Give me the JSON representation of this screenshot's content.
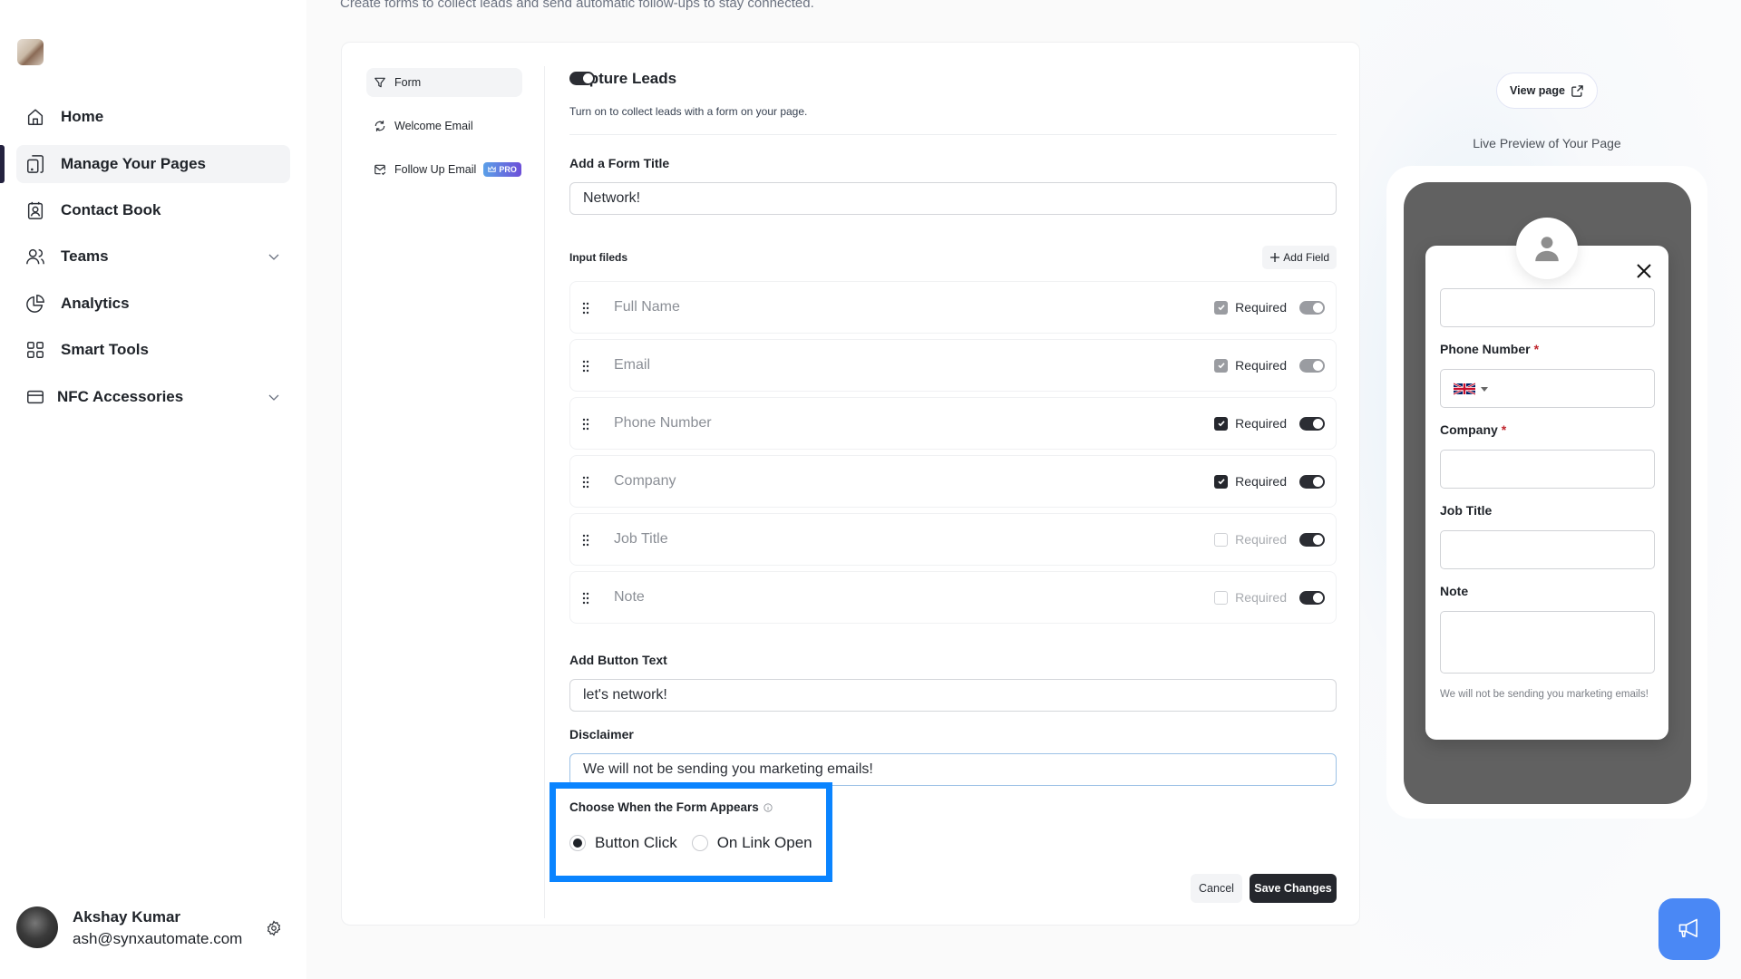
{
  "sidebar": {
    "items": [
      {
        "label": "Home",
        "icon": "home-icon",
        "active": false
      },
      {
        "label": "Manage Your Pages",
        "icon": "pages-icon",
        "active": true
      },
      {
        "label": "Contact Book",
        "icon": "contact-book-icon",
        "active": false
      },
      {
        "label": "Teams",
        "icon": "users-icon",
        "active": false,
        "expandable": true
      },
      {
        "label": "Analytics",
        "icon": "pie-chart-icon",
        "active": false
      },
      {
        "label": "Smart Tools",
        "icon": "grid-icon",
        "active": false
      },
      {
        "label": "NFC Accessories",
        "icon": "card-icon",
        "active": false,
        "expandable": true
      }
    ],
    "profile": {
      "name": "Akshay Kumar",
      "email": "ash@synxautomate.com"
    }
  },
  "page": {
    "subtitle": "Create forms to collect leads and send automatic follow-ups to stay connected."
  },
  "tabs": [
    {
      "label": "Form",
      "icon": "filter-icon",
      "active": true
    },
    {
      "label": "Welcome Email",
      "icon": "refresh-icon",
      "active": false
    },
    {
      "label": "Follow Up Email",
      "icon": "mail-check-icon",
      "active": false,
      "badge": "PRO"
    }
  ],
  "form": {
    "title": "Capture Leads",
    "description": "Turn on to collect leads with a form on your page.",
    "enabled": true,
    "form_title_label": "Add a Form Title",
    "form_title_value": "Network!",
    "input_fields_label": "Input fileds",
    "add_field_label": "Add Field",
    "required_label": "Required",
    "fields": [
      {
        "name": "Full Name",
        "required": true,
        "enabled": true,
        "locked": true
      },
      {
        "name": "Email",
        "required": true,
        "enabled": true,
        "locked": true
      },
      {
        "name": "Phone Number",
        "required": true,
        "enabled": true,
        "locked": false
      },
      {
        "name": "Company",
        "required": true,
        "enabled": true,
        "locked": false
      },
      {
        "name": "Job Title",
        "required": false,
        "enabled": true,
        "locked": false
      },
      {
        "name": "Note",
        "required": false,
        "enabled": true,
        "locked": false
      }
    ],
    "button_text_label": "Add Button Text",
    "button_text_value": "let's network!",
    "disclaimer_label": "Disclaimer",
    "disclaimer_value": "We will not be sending you marketing emails!",
    "appear_label": "Choose When the Form Appears",
    "appear_options": [
      "Button Click",
      "On Link Open"
    ],
    "appear_selected": "Button Click",
    "cancel_label": "Cancel",
    "save_label": "Save Changes"
  },
  "preview": {
    "view_page_label": "View page",
    "live_label": "Live Preview of Your Page",
    "labels": {
      "phone": "Phone Number",
      "company": "Company",
      "job_title": "Job Title",
      "note": "Note"
    },
    "required_mark": "*",
    "disclaimer": "We will not be sending you marketing emails!"
  },
  "colors": {
    "accent": "#25272d",
    "highlight": "#0a84ff",
    "fab": "#4a88f5",
    "pro_badge_start": "#5aa0e8",
    "pro_badge_end": "#6d4fd8",
    "required_star": "#c0262d"
  }
}
